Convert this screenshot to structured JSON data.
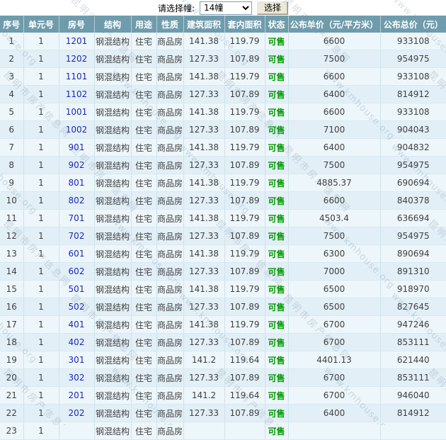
{
  "select_bar": {
    "label": "请选择幢:",
    "selected_option": "14幢",
    "button_label": "选择"
  },
  "watermark": {
    "url_text": "www.kmhouse.org",
    "cn_text": "昆明市房产信息网"
  },
  "colors": {
    "header_bg": "#6f9cac",
    "status_available": "#009900",
    "room_link": "#1f25bb",
    "row_odd_bg": "#edf6fa",
    "row_even_bg": "#e2eff7"
  },
  "table": {
    "columns": [
      "序号",
      "单元号",
      "房号",
      "结构",
      "用途",
      "性质",
      "建筑面积",
      "套内面积",
      "状态",
      "公布单价（元/平方米）",
      "公布总价（元）"
    ],
    "rows": [
      [
        "1",
        "1",
        "1201",
        "钢混结构",
        "住宅",
        "商品房",
        "141.38",
        "119.79",
        "可售",
        "6600",
        "933108"
      ],
      [
        "2",
        "1",
        "1202",
        "钢混结构",
        "住宅",
        "商品房",
        "127.33",
        "107.89",
        "可售",
        "7500",
        "954975"
      ],
      [
        "3",
        "1",
        "1101",
        "钢混结构",
        "住宅",
        "商品房",
        "141.38",
        "119.79",
        "可售",
        "6600",
        "933108"
      ],
      [
        "4",
        "1",
        "1102",
        "钢混结构",
        "住宅",
        "商品房",
        "127.33",
        "107.89",
        "可售",
        "6400",
        "814912"
      ],
      [
        "5",
        "1",
        "1001",
        "钢混结构",
        "住宅",
        "商品房",
        "141.38",
        "119.79",
        "可售",
        "6600",
        "933108"
      ],
      [
        "6",
        "1",
        "1002",
        "钢混结构",
        "住宅",
        "商品房",
        "127.33",
        "107.89",
        "可售",
        "7100",
        "904043"
      ],
      [
        "7",
        "1",
        "901",
        "钢混结构",
        "住宅",
        "商品房",
        "141.38",
        "119.79",
        "可售",
        "6400",
        "904832"
      ],
      [
        "8",
        "1",
        "902",
        "钢混结构",
        "住宅",
        "商品房",
        "127.33",
        "107.89",
        "可售",
        "7500",
        "954975"
      ],
      [
        "9",
        "1",
        "801",
        "钢混结构",
        "住宅",
        "商品房",
        "141.38",
        "119.79",
        "可售",
        "4885.37",
        "690694"
      ],
      [
        "10",
        "1",
        "802",
        "钢混结构",
        "住宅",
        "商品房",
        "127.33",
        "107.89",
        "可售",
        "6600",
        "840378"
      ],
      [
        "11",
        "1",
        "701",
        "钢混结构",
        "住宅",
        "商品房",
        "141.38",
        "119.79",
        "可售",
        "4503.4",
        "636694"
      ],
      [
        "12",
        "1",
        "702",
        "钢混结构",
        "住宅",
        "商品房",
        "127.33",
        "107.89",
        "可售",
        "7500",
        "954975"
      ],
      [
        "13",
        "1",
        "601",
        "钢混结构",
        "住宅",
        "商品房",
        "141.38",
        "119.79",
        "可售",
        "6300",
        "890694"
      ],
      [
        "14",
        "1",
        "602",
        "钢混结构",
        "住宅",
        "商品房",
        "127.33",
        "107.89",
        "可售",
        "7000",
        "891310"
      ],
      [
        "15",
        "1",
        "501",
        "钢混结构",
        "住宅",
        "商品房",
        "141.38",
        "119.79",
        "可售",
        "6500",
        "918970"
      ],
      [
        "16",
        "1",
        "502",
        "钢混结构",
        "住宅",
        "商品房",
        "127.33",
        "107.89",
        "可售",
        "6500",
        "827645"
      ],
      [
        "17",
        "1",
        "401",
        "钢混结构",
        "住宅",
        "商品房",
        "141.38",
        "119.79",
        "可售",
        "6700",
        "947246"
      ],
      [
        "18",
        "1",
        "402",
        "钢混结构",
        "住宅",
        "商品房",
        "127.33",
        "107.89",
        "可售",
        "6700",
        "853111"
      ],
      [
        "19",
        "1",
        "301",
        "钢混结构",
        "住宅",
        "商品房",
        "141.2",
        "119.64",
        "可售",
        "4401.13",
        "621440"
      ],
      [
        "20",
        "1",
        "302",
        "钢混结构",
        "住宅",
        "商品房",
        "127.33",
        "107.89",
        "可售",
        "6700",
        "853111"
      ],
      [
        "21",
        "1",
        "201",
        "钢混结构",
        "住宅",
        "商品房",
        "141.2",
        "119.64",
        "可售",
        "6700",
        "946040"
      ],
      [
        "22",
        "1",
        "202",
        "钢混结构",
        "住宅",
        "商品房",
        "127.33",
        "107.89",
        "可售",
        "6400",
        "814912"
      ],
      [
        "23",
        "1",
        "",
        "钢混结构",
        "住宅",
        "商品房",
        "",
        "",
        "可售",
        "",
        ""
      ]
    ]
  }
}
